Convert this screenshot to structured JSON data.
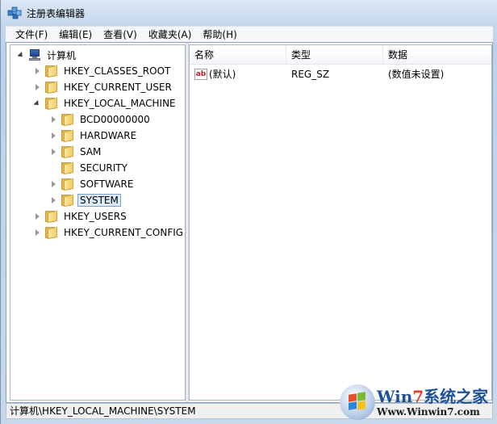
{
  "window": {
    "title": "注册表编辑器"
  },
  "menu": [
    "文件(F)",
    "编辑(E)",
    "查看(V)",
    "收藏夹(A)",
    "帮助(H)"
  ],
  "tree": {
    "root": "计算机",
    "items": [
      {
        "label": "HKEY_CLASSES_ROOT"
      },
      {
        "label": "HKEY_CURRENT_USER"
      },
      {
        "label": "HKEY_LOCAL_MACHINE"
      },
      {
        "label": "BCD00000000"
      },
      {
        "label": "HARDWARE"
      },
      {
        "label": "SAM"
      },
      {
        "label": "SECURITY"
      },
      {
        "label": "SOFTWARE"
      },
      {
        "label": "SYSTEM"
      },
      {
        "label": "HKEY_USERS"
      },
      {
        "label": "HKEY_CURRENT_CONFIG"
      }
    ],
    "selected": "SYSTEM"
  },
  "list": {
    "columns": [
      "名称",
      "类型",
      "数据"
    ],
    "rows": [
      {
        "name": "(默认)",
        "type": "REG_SZ",
        "data": "(数值未设置)",
        "icon": "ab-string-icon"
      }
    ]
  },
  "status": {
    "path": "计算机\\HKEY_LOCAL_MACHINE\\SYSTEM"
  },
  "watermark": {
    "brand_a": "Win",
    "brand_seven": "7",
    "brand_b": "系统之家",
    "url": "Www.Winwin7.com"
  },
  "colors": {
    "selection": "#dceaf8",
    "title_gradient_top": "#dbe7f4",
    "string_icon": "#c4221f"
  }
}
